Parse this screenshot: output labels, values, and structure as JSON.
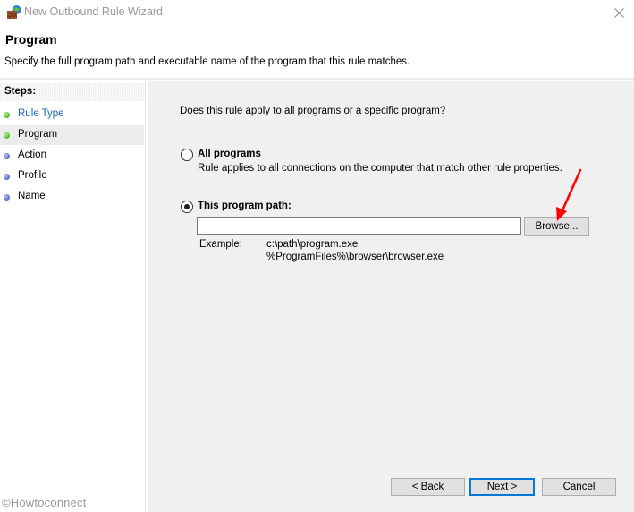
{
  "window": {
    "title": "New Outbound Rule Wizard",
    "icon": "firewall-globe-icon",
    "close_icon": "close-icon"
  },
  "header": {
    "title": "Program",
    "description": "Specify the full program path and executable name of the program that this rule matches."
  },
  "steps": {
    "heading": "Steps:",
    "items": [
      {
        "label": "Rule Type",
        "status": "completed",
        "dot_color": "#4fb82a",
        "is_link": true
      },
      {
        "label": "Program",
        "status": "current",
        "dot_color": "#4fb82a",
        "is_link": false
      },
      {
        "label": "Action",
        "status": "pending",
        "dot_color": "#5b64c2",
        "is_link": false
      },
      {
        "label": "Profile",
        "status": "pending",
        "dot_color": "#5b64c2",
        "is_link": false
      },
      {
        "label": "Name",
        "status": "pending",
        "dot_color": "#5b64c2",
        "is_link": false
      }
    ]
  },
  "main": {
    "question": "Does this rule apply to all programs or a specific program?",
    "options": [
      {
        "label": "All programs",
        "description": "Rule applies to all connections on the computer that match other rule properties.",
        "selected": false
      },
      {
        "label": "This program path:",
        "selected": true
      }
    ],
    "path_input": {
      "value": "",
      "placeholder": ""
    },
    "browse_label": "Browse...",
    "example_label": "Example:",
    "example_lines": [
      "c:\\path\\program.exe",
      "%ProgramFiles%\\browser\\browser.exe"
    ]
  },
  "footer": {
    "back_label": "< Back",
    "next_label": "Next >",
    "cancel_label": "Cancel"
  },
  "annotation": {
    "arrow_color": "#ff0000",
    "points_to": "Browse..."
  },
  "watermark": "©Howtoconnect",
  "colors": {
    "accent": "#0078d7",
    "link": "#1a64b8",
    "content_bg": "#f0f0f0"
  }
}
